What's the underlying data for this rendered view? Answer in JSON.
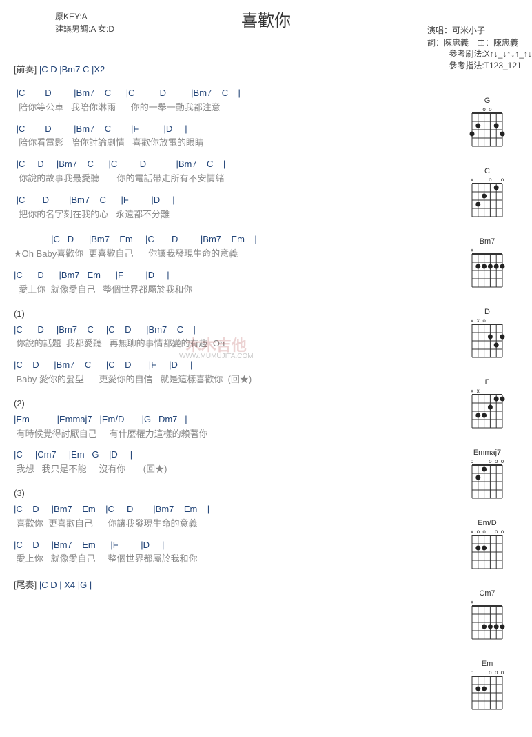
{
  "title": "喜歡你",
  "key_info": {
    "line1": "原KEY:A",
    "line2": "建議男調:A 女:D"
  },
  "credits": {
    "singer": "演唱：可米小子",
    "writer": "詞：陳忠義　曲：陳忠義"
  },
  "ref": {
    "strum": "參考刷法:X↑↓_↓↑↓↑_↑↓",
    "pick": "參考指法:T123_121"
  },
  "intro": {
    "label": "[前奏]",
    "chords": "|C   D    |Bm7   C    |X2"
  },
  "verse1": [
    {
      "c": " |C        D         |Bm7    C      |C          D          |Bm7    C    |",
      "l": "  陪你等公車   我陪你淋雨      你的一舉一動我都注意"
    },
    {
      "c": " |C        D         |Bm7    C        |F          |D     |",
      "l": "  陪你看電影   陪你討論劇情   喜歡你放電的眼睛"
    },
    {
      "c": " |C     D     |Bm7    C      |C         D            |Bm7    C    |",
      "l": "  你說的故事我最愛聽       你的電話帶走所有不安情緒"
    },
    {
      "c": " |C       D        |Bm7    C      |F         |D     |",
      "l": "  把你的名字刻在我的心   永遠都不分離"
    }
  ],
  "chorus": [
    {
      "c": "               |C   D      |Bm7    Em     |C       D         |Bm7    Em    |",
      "l": "★Oh Baby喜歡你  更喜歡自己      你讓我發現生命的意義"
    },
    {
      "c": "|C      D      |Bm7   Em      |F         |D     |",
      "l": "  愛上你  就像愛自己   整個世界都屬於我和你"
    }
  ],
  "sec1": {
    "label": "(1)",
    "lines": [
      {
        "c": "|C      D     |Bm7    C     |C    D      |Bm7    C    |",
        "l": " 你說的話題  我都愛聽   再無聊的事情都變的有趣  Oh"
      },
      {
        "c": "|C    D      |Bm7    C      |C    D       |F     |D     |",
        "l": " Baby 愛你的髮型      更愛你的自信   就是這樣喜歡你  (回★)"
      }
    ]
  },
  "sec2": {
    "label": "(2)",
    "lines": [
      {
        "c": "|Em           |Emmaj7   |Em/D       |G   Dm7   |",
        "l": " 有時候覺得討厭自己     有什麼權力這樣的賴著你"
      },
      {
        "c": "|C     |Cm7     |Em   G    |D     |",
        "l": " 我想   我只是不能     沒有你       (回★)"
      }
    ]
  },
  "sec3": {
    "label": "(3)",
    "lines": [
      {
        "c": "|C    D     |Bm7    Em    |C     D        |Bm7    Em    |",
        "l": " 喜歡你  更喜歡自己      你讓我發現生命的意義"
      },
      {
        "c": "|C    D     |Bm7    Em      |F         |D     |",
        "l": " 愛上你   就像愛自己     整個世界都屬於我和你"
      }
    ]
  },
  "outro": {
    "label": "[尾奏]",
    "chords": "|C   D     | X4 |G     |"
  },
  "watermark": {
    "main": "木木吉他",
    "sub": "WWW.MUMUJITA.COM"
  },
  "chord_diagrams": [
    "G",
    "C",
    "Bm7",
    "D",
    "F",
    "Emmaj7",
    "Em/D",
    "Cm7",
    "Em"
  ]
}
